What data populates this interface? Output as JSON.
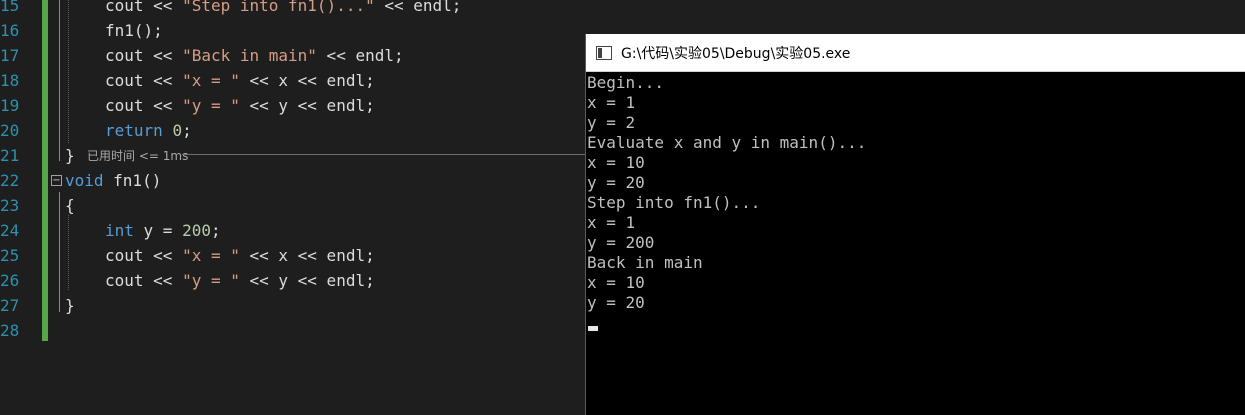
{
  "editor": {
    "line_numbers": [
      "15",
      "16",
      "17",
      "18",
      "19",
      "20",
      "21",
      "22",
      "23",
      "24",
      "25",
      "26",
      "27",
      "28"
    ],
    "code": {
      "l15": {
        "a": "cout << ",
        "s": "\"Step into fn1()...\"",
        "b": " << endl;"
      },
      "l16": {
        "a": "fn1();"
      },
      "l17": {
        "a": "cout << ",
        "s": "\"Back in main\"",
        "b": " << endl;"
      },
      "l18": {
        "a": "cout << ",
        "s": "\"x = \"",
        "b": " << x << endl;"
      },
      "l19": {
        "a": "cout << ",
        "s": "\"y = \"",
        "b": " << y << endl;"
      },
      "l20": {
        "kw": "return",
        "sp": " ",
        "n": "0",
        "b": ";"
      },
      "l21": {
        "brace": "}"
      },
      "l22": {
        "kw": "void",
        "b": " fn1()"
      },
      "l23": {
        "brace": "{"
      },
      "l24": {
        "kw": "int",
        "a": " y = ",
        "n": "200",
        "b": ";"
      },
      "l25": {
        "a": "cout << ",
        "s": "\"x = \"",
        "b": " << x << endl;"
      },
      "l26": {
        "a": "cout << ",
        "s": "\"y = \"",
        "b": " << y << endl;"
      },
      "l27": {
        "brace": "}"
      }
    },
    "perf_hint": "已用时间 <= 1ms",
    "collapse_glyph": "−"
  },
  "console": {
    "title": "G:\\代码\\实验05\\Debug\\实验05.exe",
    "lines": [
      "Begin...",
      "x = 1",
      "y = 2",
      "Evaluate x and y in main()...",
      "x = 10",
      "y = 20",
      "Step into fn1()...",
      "x = 1",
      "y = 200",
      "Back in main",
      "x = 10",
      "y = 20"
    ]
  }
}
